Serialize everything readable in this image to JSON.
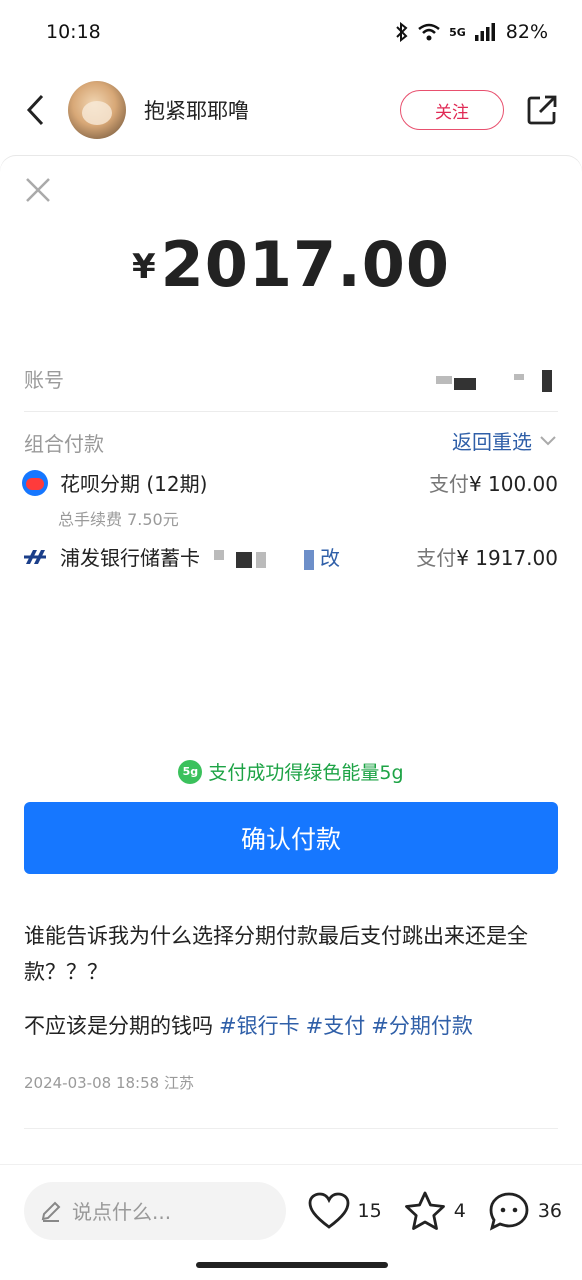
{
  "status_bar": {
    "time": "10:18",
    "network": "5G",
    "battery": "82%"
  },
  "header": {
    "username": "抱紧耶耶噜",
    "follow_label": "关注"
  },
  "payment": {
    "amount_symbol": "¥",
    "amount": "2017.00",
    "account_label": "账号",
    "combo_label": "组合付款",
    "reselect_label": "返回重选",
    "methods": [
      {
        "name": "花呗分期 (12期)",
        "pay_label": "支付",
        "amount": "¥ 100.00",
        "fee": "总手续费 7.50元"
      },
      {
        "name": "浦发银行储蓄卡",
        "change_label": "改",
        "pay_label": "支付",
        "amount": "¥ 1917.00"
      }
    ],
    "energy_badge": "5g",
    "energy_text": "支付成功得绿色能量5g",
    "confirm_label": "确认付款"
  },
  "post": {
    "text_1": "谁能告诉我为什么选择分期付款最后支付跳出来还是全款？？？",
    "text_2": "不应该是分期的钱吗",
    "tags": [
      "#银行卡",
      "#支付",
      "#分期付款"
    ],
    "date": "2024-03-08 18:58",
    "location": "江苏"
  },
  "bottom_bar": {
    "comment_placeholder": "说点什么...",
    "likes": "15",
    "collects": "4",
    "comments": "36"
  }
}
